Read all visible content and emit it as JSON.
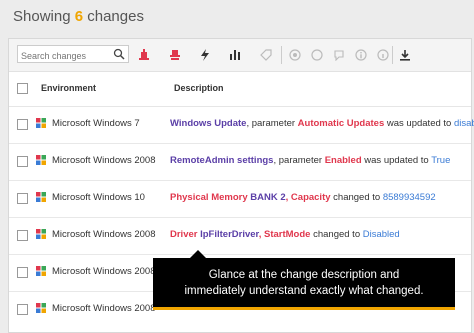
{
  "header": {
    "prefix": "Showing",
    "count": "6",
    "suffix": "changes"
  },
  "search": {
    "placeholder": "Search changes"
  },
  "columns": {
    "environment": "Environment",
    "description": "Description"
  },
  "rows": [
    {
      "env": "Microsoft Windows 7",
      "d1": "Windows Update",
      "d2": ", parameter ",
      "d3": "Automatic Updates",
      "d4": " was updated to ",
      "d5": "disabled"
    },
    {
      "env": "Microsoft Windows 2008",
      "d1": "RemoteAdmin settings",
      "d2": ", parameter ",
      "d3": "Enabled",
      "d4": " was updated to ",
      "d5": "True"
    },
    {
      "env": "Microsoft Windows 10",
      "d1": "Physical Memory",
      "d2": " BANK 2",
      "d3": ", Capacity",
      "d4": " changed to ",
      "d5": "8589934592"
    },
    {
      "env": "Microsoft Windows 2008",
      "d1": "Driver",
      "d2": " IpFilterDriver",
      "d3": ", StartMode",
      "d4": " changed to ",
      "d5": "Disabled"
    },
    {
      "env": "Microsoft Windows 2008"
    },
    {
      "env": "Microsoft Windows 2008"
    }
  ],
  "tooltip": {
    "line1": "Glance at the change description and",
    "line2": "immediately understand exactly what changed."
  },
  "colors": {
    "accent": "#f0a500",
    "red": "#e0374d",
    "purple": "#5b3fa7",
    "blue": "#3a7bd5"
  }
}
